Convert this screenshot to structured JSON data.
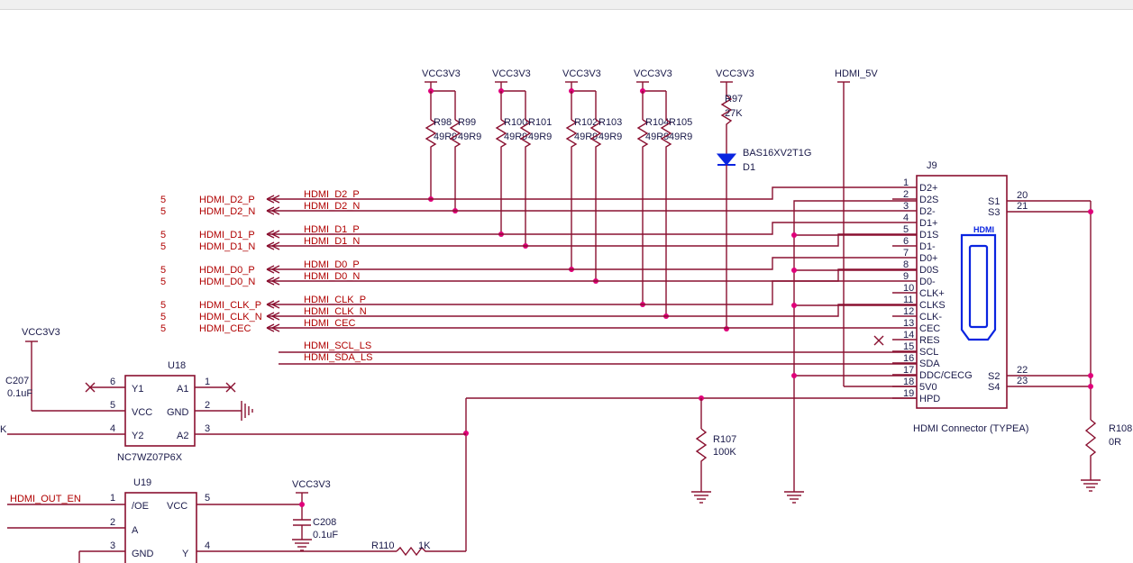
{
  "power": {
    "vcc": "VCC3V3",
    "hdmi5v": "HDMI_5V"
  },
  "resistors_top": [
    {
      "ref": "R98",
      "val": "49R9"
    },
    {
      "ref": "R99",
      "val": "49R9"
    },
    {
      "ref": "R100",
      "val": "49R9"
    },
    {
      "ref": "R101",
      "val": "49R9"
    },
    {
      "ref": "R102",
      "val": "49R9"
    },
    {
      "ref": "R103",
      "val": "49R9"
    },
    {
      "ref": "R104",
      "val": "49R9"
    },
    {
      "ref": "R105",
      "val": "49R9"
    }
  ],
  "r97": {
    "ref": "R97",
    "val": "27K"
  },
  "diode": {
    "part": "BAS16XV2T1G",
    "ref": "D1"
  },
  "signals": [
    {
      "sheet": "5",
      "port": "HDMI_D2_P",
      "net": "HDMI_D2_P"
    },
    {
      "sheet": "5",
      "port": "HDMI_D2_N",
      "net": "HDMI_D2_N"
    },
    {
      "sheet": "5",
      "port": "HDMI_D1_P",
      "net": "HDMI_D1_P"
    },
    {
      "sheet": "5",
      "port": "HDMI_D1_N",
      "net": "HDMI_D1_N"
    },
    {
      "sheet": "5",
      "port": "HDMI_D0_P",
      "net": "HDMI_D0_P"
    },
    {
      "sheet": "5",
      "port": "HDMI_D0_N",
      "net": "HDMI_D0_N"
    },
    {
      "sheet": "5",
      "port": "HDMI_CLK_P",
      "net": "HDMI_CLK_P"
    },
    {
      "sheet": "5",
      "port": "HDMI_CLK_N",
      "net": "HDMI_CLK_N"
    },
    {
      "sheet": "5",
      "port": "HDMI_CEC",
      "net": "HDMI_CEC"
    }
  ],
  "ddc_nets": [
    "HDMI_SCL_LS",
    "HDMI_SDA_LS"
  ],
  "connector": {
    "ref": "J9",
    "title": "HDMI Connector (TYPEA)",
    "logo": "HDMI",
    "pins": [
      {
        "num": "1",
        "name": "D2+"
      },
      {
        "num": "2",
        "name": "D2S"
      },
      {
        "num": "3",
        "name": "D2-"
      },
      {
        "num": "4",
        "name": "D1+"
      },
      {
        "num": "5",
        "name": "D1S"
      },
      {
        "num": "6",
        "name": "D1-"
      },
      {
        "num": "7",
        "name": "D0+"
      },
      {
        "num": "8",
        "name": "D0S"
      },
      {
        "num": "9",
        "name": "D0-"
      },
      {
        "num": "10",
        "name": "CLK+"
      },
      {
        "num": "11",
        "name": "CLKS"
      },
      {
        "num": "12",
        "name": "CLK-"
      },
      {
        "num": "13",
        "name": "CEC"
      },
      {
        "num": "14",
        "name": "RES"
      },
      {
        "num": "15",
        "name": "SCL"
      },
      {
        "num": "16",
        "name": "SDA"
      },
      {
        "num": "17",
        "name": "DDC/CECG"
      },
      {
        "num": "18",
        "name": "5V0"
      },
      {
        "num": "19",
        "name": "HPD"
      }
    ],
    "shield_pins": [
      {
        "num": "20",
        "name": "S1"
      },
      {
        "num": "21",
        "name": "S3"
      },
      {
        "num": "22",
        "name": "S2"
      },
      {
        "num": "23",
        "name": "S4"
      }
    ]
  },
  "r107": {
    "ref": "R107",
    "val": "100K"
  },
  "r108": {
    "ref": "R108",
    "val": "0R"
  },
  "r110": {
    "ref": "R110",
    "val": "1K"
  },
  "c207": {
    "ref": "C207",
    "val": "0.1uF"
  },
  "c208": {
    "ref": "C208",
    "val": "0.1uF"
  },
  "u18": {
    "ref": "U18",
    "part": "NC7WZ07P6X",
    "pins": [
      {
        "num": "6",
        "name": "Y1"
      },
      {
        "num": "5",
        "name": "VCC"
      },
      {
        "num": "4",
        "name": "Y2"
      },
      {
        "num": "1",
        "name": "A1"
      },
      {
        "num": "2",
        "name": "GND"
      },
      {
        "num": "3",
        "name": "A2"
      }
    ]
  },
  "u19": {
    "ref": "U19",
    "pins": [
      {
        "num": "1",
        "name": "/OE"
      },
      {
        "num": "2",
        "name": "A"
      },
      {
        "num": "3",
        "name": "GND"
      },
      {
        "num": "5",
        "name": "VCC"
      },
      {
        "num": "4",
        "name": "Y"
      }
    ]
  },
  "hdmi_out_en": "HDMI_OUT_EN",
  "edge_fragment": "K"
}
